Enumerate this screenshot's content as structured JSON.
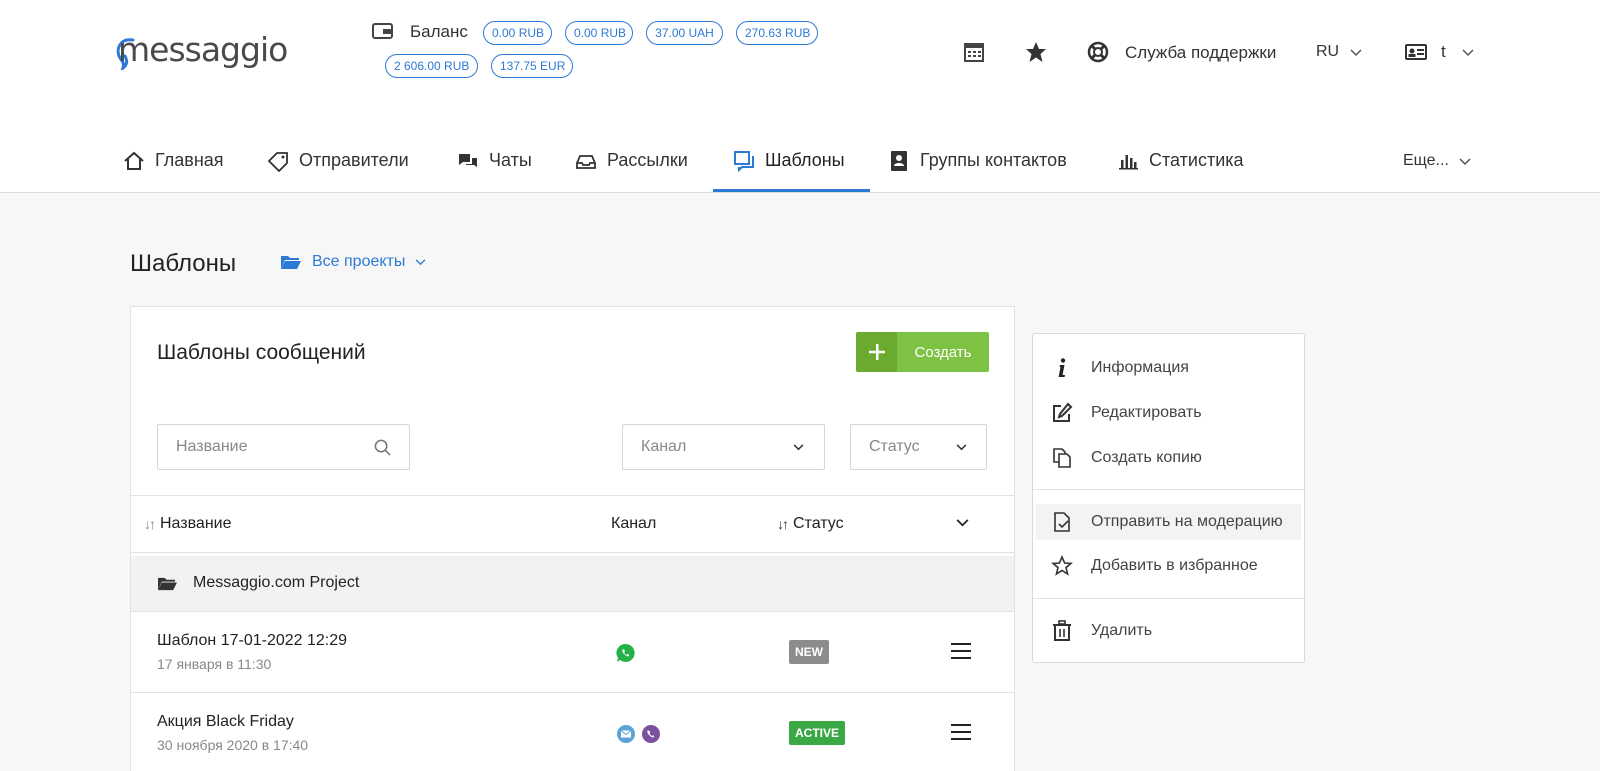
{
  "header": {
    "logo_text": "messaggio",
    "balance_label": "Баланс",
    "balances": [
      "0.00 RUB",
      "0.00 RUB",
      "37.00 UAH",
      "270.63 RUB",
      "2 606.00 RUB",
      "137.75 EUR"
    ],
    "support_label": "Служба поддержки",
    "language": "RU",
    "user_initial": "t"
  },
  "nav": {
    "items": [
      {
        "label": "Главная",
        "icon": "home-icon"
      },
      {
        "label": "Отправители",
        "icon": "tag-icon"
      },
      {
        "label": "Чаты",
        "icon": "chat-icon"
      },
      {
        "label": "Рассылки",
        "icon": "inbox-icon"
      },
      {
        "label": "Шаблоны",
        "icon": "templates-icon",
        "active": true
      },
      {
        "label": "Группы контактов",
        "icon": "address-book-icon"
      },
      {
        "label": "Статистика",
        "icon": "bar-chart-icon"
      }
    ],
    "more_label": "Еще..."
  },
  "page": {
    "title": "Шаблоны",
    "project_select": "Все проекты"
  },
  "card": {
    "title": "Шаблоны сообщений",
    "create_label": "Создать",
    "search_placeholder": "Название",
    "channel_placeholder": "Канал",
    "status_placeholder": "Статус"
  },
  "table": {
    "headers": {
      "name": "Название",
      "channel": "Канал",
      "status": "Статус"
    },
    "group": "Messaggio.com Project",
    "rows": [
      {
        "title": "Шаблон 17-01-2022 12:29",
        "date": "17 января в 11:30",
        "channels": [
          "whatsapp-icon"
        ],
        "status": "NEW"
      },
      {
        "title": "Акция Black Friday",
        "date": "30 ноября 2020 в 17:40",
        "channels": [
          "email-icon",
          "viber-icon"
        ],
        "status": "ACTIVE"
      }
    ]
  },
  "context_menu": {
    "items": [
      {
        "label": "Информация",
        "icon": "info-icon"
      },
      {
        "label": "Редактировать",
        "icon": "edit-icon"
      },
      {
        "label": "Создать копию",
        "icon": "copy-icon"
      },
      {
        "label": "Отправить на модерацию",
        "icon": "send-moderation-icon"
      },
      {
        "label": "Добавить в избранное",
        "icon": "star-outline-icon"
      },
      {
        "label": "Удалить",
        "icon": "trash-icon"
      }
    ]
  },
  "colors": {
    "accent": "#2d7ad6",
    "create_green": "#7dc242",
    "new_badge": "#8c8c8c",
    "active_badge": "#3aa845",
    "whatsapp": "#25b14a",
    "viber": "#7b519d",
    "email": "#5aa5d6"
  }
}
